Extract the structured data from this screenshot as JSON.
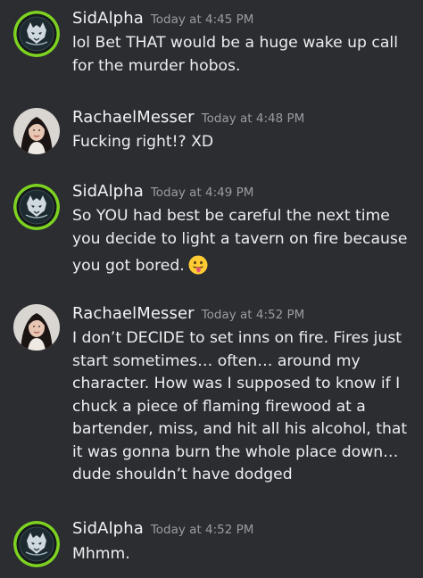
{
  "messages": [
    {
      "author": "SidAlpha",
      "timestamp": "Today at 4:45 PM",
      "avatar_icon": "sidalpha-wolf-avatar-icon",
      "lines": [
        "lol Bet THAT would be a huge wake up call",
        "for the murder hobos."
      ]
    },
    {
      "author": "RachaelMesser",
      "timestamp": "Today at 4:48 PM",
      "avatar_icon": "rachaelmesser-portrait-avatar-icon",
      "lines": [
        "Fucking right!? XD"
      ]
    },
    {
      "author": "SidAlpha",
      "timestamp": "Today at 4:49 PM",
      "avatar_icon": "sidalpha-wolf-avatar-icon",
      "lines": [
        "So YOU had best be careful the next time",
        "you decide to light a tavern on fire because",
        "you got bored."
      ],
      "emoji": "tongue-out-emoji-icon"
    },
    {
      "author": "RachaelMesser",
      "timestamp": "Today at 4:52 PM",
      "avatar_icon": "rachaelmesser-portrait-avatar-icon",
      "lines": [
        "I don’t DECIDE to set inns on fire. Fires just",
        "start sometimes… often… around my",
        "character. How was I supposed to know if I",
        "chuck a piece of flaming firewood at a",
        "bartender, miss, and hit all his alcohol, that",
        "it was gonna burn the whole place down…",
        "dude shouldn’t have dodged"
      ]
    },
    {
      "author": "SidAlpha",
      "timestamp": "Today at 4:52 PM",
      "avatar_icon": "sidalpha-wolf-avatar-icon",
      "lines": [
        "Mhmm."
      ]
    }
  ],
  "colors": {
    "background": "#2c2d31",
    "username": "#f2f3f5",
    "timestamp": "#9a9ca3",
    "text": "#eceef0",
    "sidalpha_ring": "#7ed321"
  }
}
